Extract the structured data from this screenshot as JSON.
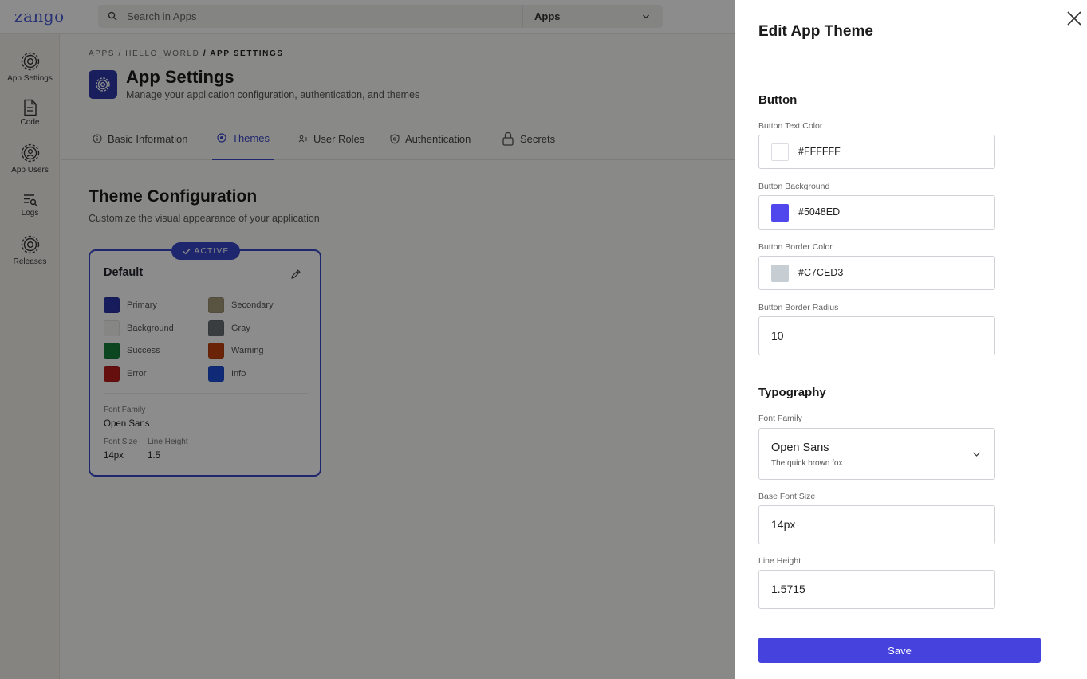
{
  "app": {
    "logo": "zango"
  },
  "search": {
    "placeholder": "Search in Apps",
    "scope": "Apps"
  },
  "sidebar": {
    "items": [
      {
        "label": "App Settings",
        "icon": "gear-icon"
      },
      {
        "label": "Code",
        "icon": "file-icon"
      },
      {
        "label": "App Users",
        "icon": "users-gear-icon"
      },
      {
        "label": "Logs",
        "icon": "log-search-icon"
      },
      {
        "label": "Releases",
        "icon": "gear-icon"
      }
    ]
  },
  "breadcrumb": {
    "part1": "APPS",
    "sep": "/",
    "part2": "HELLO_WORLD",
    "current": "/ APP SETTINGS"
  },
  "header": {
    "title": "App Settings",
    "subtitle": "Manage your application configuration, authentication, and themes"
  },
  "tabs": [
    {
      "label": "Basic Information",
      "icon": "info-icon"
    },
    {
      "label": "Themes",
      "icon": "palette-icon",
      "active": true
    },
    {
      "label": "User Roles",
      "icon": "user-roles-icon"
    },
    {
      "label": "Authentication",
      "icon": "shield-icon"
    },
    {
      "label": "Secrets",
      "icon": "lock-icon"
    }
  ],
  "themes_section": {
    "title": "Theme Configuration",
    "subtitle": "Customize the visual appearance of your application"
  },
  "theme_card": {
    "badge": "ACTIVE",
    "name": "Default",
    "swatches": [
      {
        "label": "Primary",
        "color": "#2B36A8"
      },
      {
        "label": "Secondary",
        "color": "#A39878"
      },
      {
        "label": "Background",
        "color": "#F5F5F3"
      },
      {
        "label": "Gray",
        "color": "#6B6F76"
      },
      {
        "label": "Success",
        "color": "#15803D"
      },
      {
        "label": "Warning",
        "color": "#C2410C"
      },
      {
        "label": "Error",
        "color": "#B91C1C"
      },
      {
        "label": "Info",
        "color": "#1D4ED8"
      }
    ],
    "font_family_label": "Font Family",
    "font_family": "Open Sans",
    "font_size_label": "Font Size",
    "font_size": "14px",
    "line_height_label": "Line Height",
    "line_height": "1.5"
  },
  "drawer": {
    "title": "Edit App Theme",
    "button_section": {
      "title": "Button",
      "text_color_label": "Button Text Color",
      "text_color": "#FFFFFF",
      "background_label": "Button Background",
      "background": "#5048ED",
      "border_color_label": "Button Border Color",
      "border_color": "#C7CED3",
      "border_radius_label": "Button Border Radius",
      "border_radius": "10"
    },
    "typography_section": {
      "title": "Typography",
      "font_family_label": "Font Family",
      "font_family": "Open Sans",
      "font_preview": "The quick brown fox",
      "base_font_size_label": "Base Font Size",
      "base_font_size": "14px",
      "line_height_label": "Line Height",
      "line_height": "1.5715"
    },
    "save_label": "Save"
  }
}
